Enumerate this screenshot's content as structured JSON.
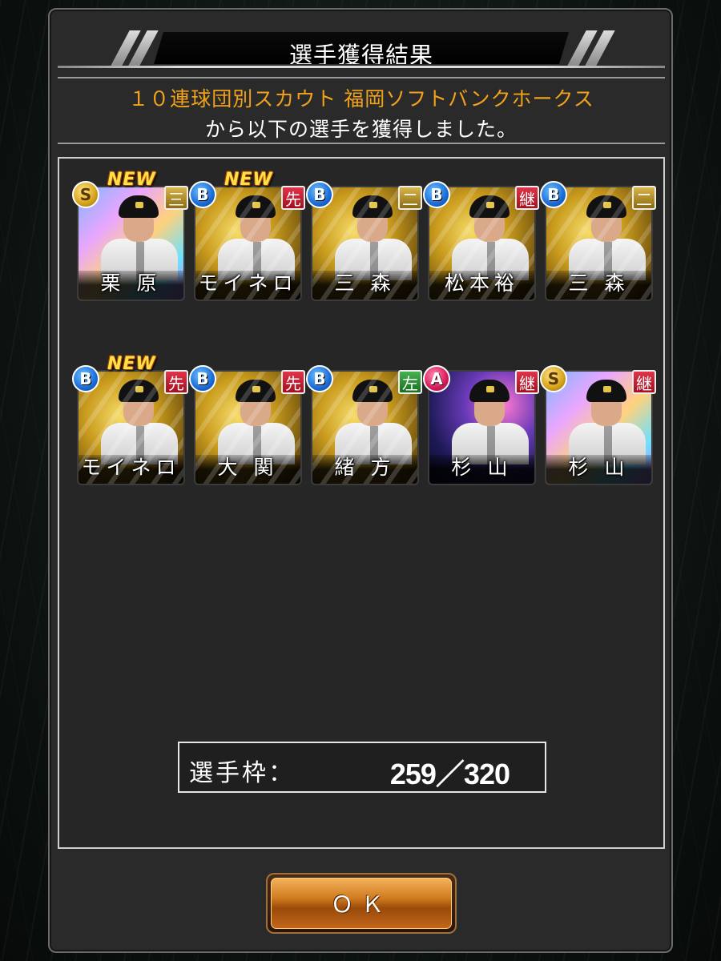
{
  "header": {
    "title": "選手獲得結果"
  },
  "subtitle": {
    "line1": "１０連球団別スカウト 福岡ソフトバンクホークス",
    "line2": "から以下の選手を獲得しました。"
  },
  "cards": [
    {
      "name": "栗 原",
      "rank": "S",
      "position": "三",
      "new": "NEW"
    },
    {
      "name": "モイネロ",
      "rank": "B",
      "position": "先",
      "new": "NEW"
    },
    {
      "name": "三 森",
      "rank": "B",
      "position": "二",
      "new": ""
    },
    {
      "name": "松本裕",
      "rank": "B",
      "position": "継",
      "new": ""
    },
    {
      "name": "三 森",
      "rank": "B",
      "position": "二",
      "new": ""
    },
    {
      "name": "モイネロ",
      "rank": "B",
      "position": "先",
      "new": "NEW"
    },
    {
      "name": "大 関",
      "rank": "B",
      "position": "先",
      "new": ""
    },
    {
      "name": "緒 方",
      "rank": "B",
      "position": "左",
      "new": ""
    },
    {
      "name": "杉 山",
      "rank": "A",
      "position": "継",
      "new": ""
    },
    {
      "name": "杉 山",
      "rank": "S",
      "position": "継",
      "new": ""
    }
  ],
  "roster": {
    "label": "選手枠：",
    "value": "259／320"
  },
  "ok_button": {
    "label": "ＯＫ"
  },
  "colors": {
    "subtitle_orange": "#f2a21a",
    "rank_B": "#1a6cd8",
    "rank_S": "#d6a21a",
    "rank_A": "#d81a5a",
    "pos_red": "#a3101f",
    "pos_gold": "#8a6a12",
    "pos_green": "#1a6f20",
    "button_orange": "#d07a1e"
  }
}
